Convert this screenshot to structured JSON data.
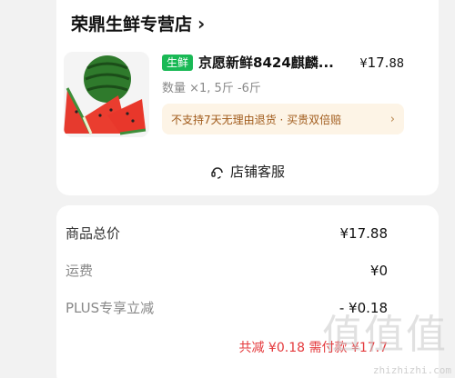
{
  "store": {
    "name": "荣鼎生鲜专营店",
    "chevron_icon": "chevron-right-icon"
  },
  "product": {
    "tag": "生鲜",
    "name": "京愿新鲜8424麒麟...",
    "price_symbol": "¥",
    "price_int": "17.",
    "price_dec": "88",
    "quantity": "数量 ×1, 5斤 -6斤",
    "image_icon": "watermelon-image"
  },
  "notice": {
    "text": "不支持7天无理由退货 · 买贵双倍赔",
    "chevron": "›"
  },
  "service": {
    "label": "店铺客服",
    "icon": "headset-icon"
  },
  "costs": {
    "goods_label": "商品总价",
    "goods_value": "¥17.88",
    "shipping_label": "运费",
    "shipping_value": "¥0",
    "plus_label": "PLUS专享立减",
    "plus_value": "- ¥0.18"
  },
  "summary": {
    "text": "共减 ¥0.18 需付款 ¥17.7"
  },
  "watermark": {
    "glyphs": "值值值",
    "site": "zhizhizhi.com"
  },
  "colors": {
    "accent_red": "#e4393c",
    "fresh_tag_green": "#19b955",
    "notice_bg": "#fdf4e6"
  }
}
